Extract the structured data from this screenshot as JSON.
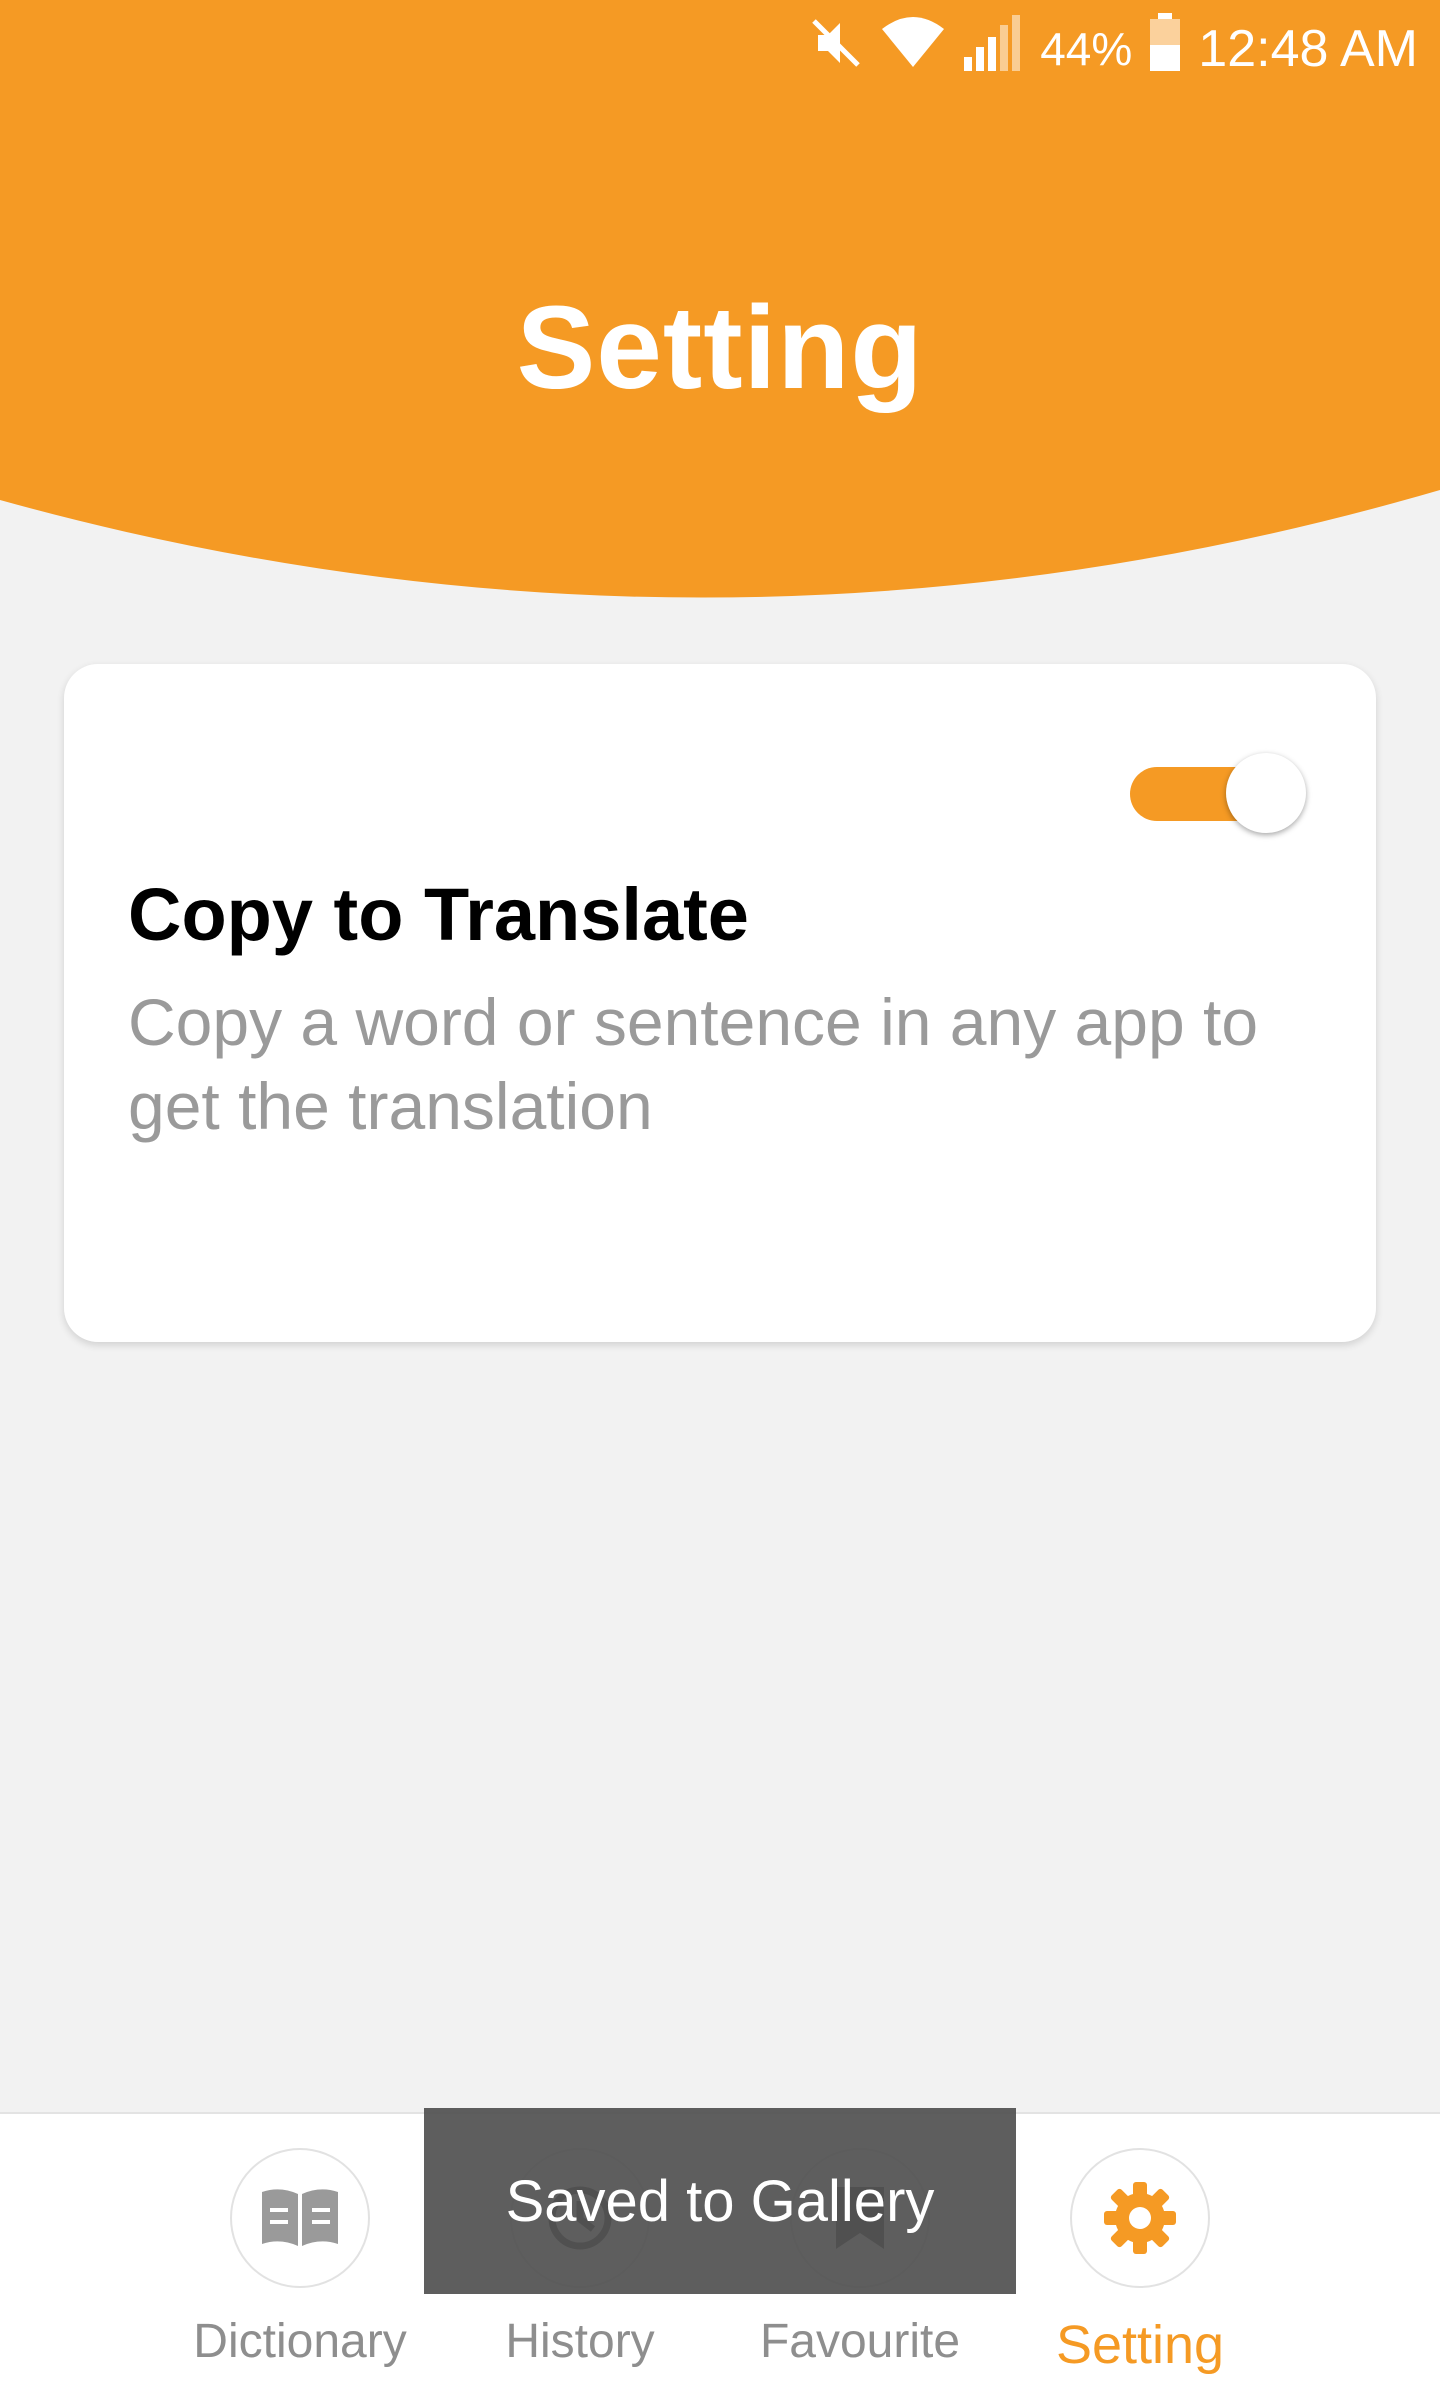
{
  "status_bar": {
    "battery_percent": "44%",
    "time": "12:48 AM",
    "icons": [
      "mute-icon",
      "wifi-icon",
      "signal-icon",
      "battery-icon"
    ]
  },
  "header": {
    "title": "Setting"
  },
  "setting_card": {
    "toggle_state": "on",
    "title": "Copy to Translate",
    "description": "Copy a word or sentence in any app to get the translation"
  },
  "bottom_nav": {
    "items": [
      {
        "label": "Dictionary",
        "icon": "book-icon",
        "active": false
      },
      {
        "label": "History",
        "icon": "history-icon",
        "active": false
      },
      {
        "label": "Favourite",
        "icon": "bookmark-icon",
        "active": false
      },
      {
        "label": "Setting",
        "icon": "gear-icon",
        "active": true
      }
    ]
  },
  "toast": {
    "message": "Saved to Gallery"
  },
  "colors": {
    "accent": "#f59a24",
    "background": "#f2f2f2",
    "inactive": "#8e8e8e"
  }
}
